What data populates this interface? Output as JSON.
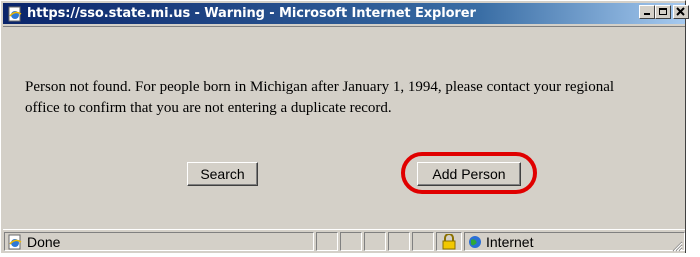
{
  "window": {
    "title": "https://sso.state.mi.us - Warning - Microsoft Internet Explorer"
  },
  "dialog": {
    "message": "Person not found. For people born in Michigan after January 1, 1994, please contact your regional office to confirm that you are not entering a duplicate record.",
    "search_label": "Search",
    "add_person_label": "Add Person"
  },
  "statusbar": {
    "status_text": "Done",
    "zone_text": "Internet"
  },
  "colors": {
    "highlight": "#e00000",
    "titlebar_start": "#0a246a",
    "titlebar_end": "#a6caf0",
    "face": "#d4d0c8"
  },
  "icons": [
    "ie-page-icon",
    "minimize-icon",
    "maximize-icon",
    "close-icon",
    "ie-done-icon",
    "lock-icon",
    "globe-icon",
    "resize-grip-icon"
  ]
}
